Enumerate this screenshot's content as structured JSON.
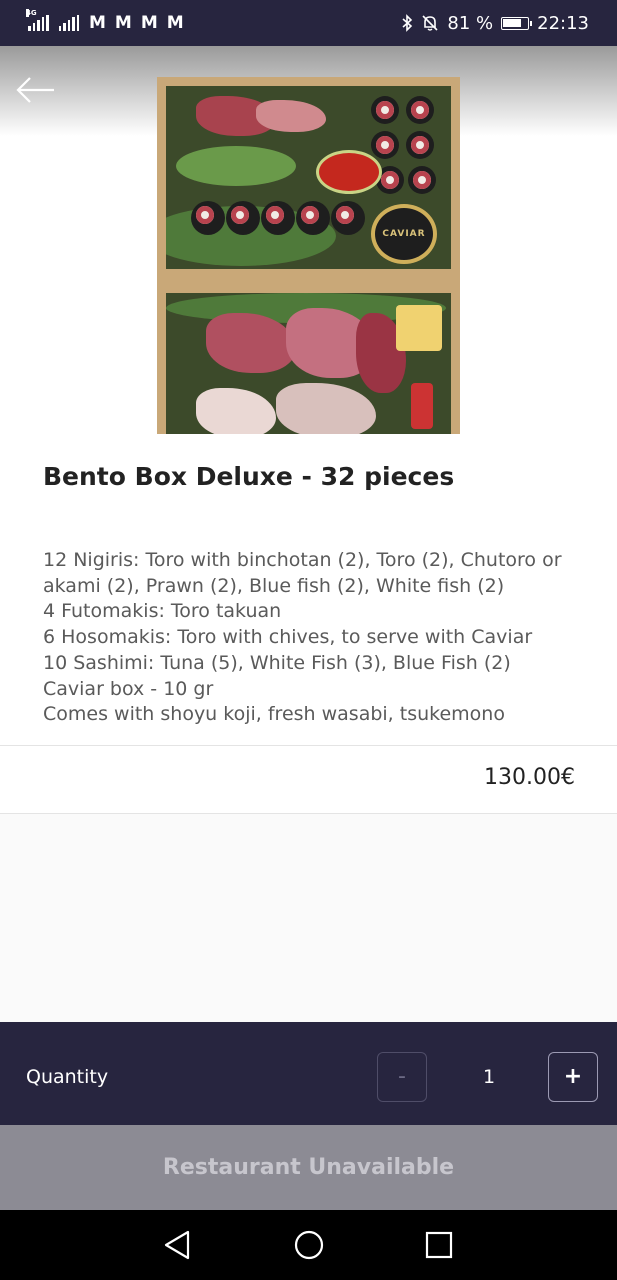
{
  "status_bar": {
    "network": "4G",
    "battery_percent": "81 %",
    "time": "22:13"
  },
  "product": {
    "title": "Bento Box Deluxe - 32 pieces",
    "description_lines": [
      "12 Nigiris: Toro with binchotan (2), Toro (2), Chutoro or akami (2), Prawn (2), Blue fish (2), White fish (2)",
      "4 Futomakis: Toro takuan",
      "6 Hosomakis: Toro with chives, to serve with Caviar",
      "10 Sashimi: Tuna (5), White Fish (3), Blue Fish (2)",
      "Caviar box - 10 gr",
      "Comes with shoyu koji, fresh wasabi, tsukemono"
    ],
    "image_label": "CAVIAR",
    "price": "130.00€"
  },
  "quantity": {
    "label": "Quantity",
    "minus": "-",
    "value": "1",
    "plus": "+"
  },
  "action_button": "Restaurant Unavailable",
  "icons": [
    "back-arrow-icon",
    "bluetooth-icon",
    "bell-off-icon",
    "battery-icon",
    "gmail-icon",
    "nav-back-icon",
    "nav-home-icon",
    "nav-recents-icon"
  ],
  "colors": {
    "header_bg": "#27253f",
    "button_disabled_bg": "#8c8b94",
    "text_dark": "#222222",
    "text_muted": "#5a5a5a"
  }
}
